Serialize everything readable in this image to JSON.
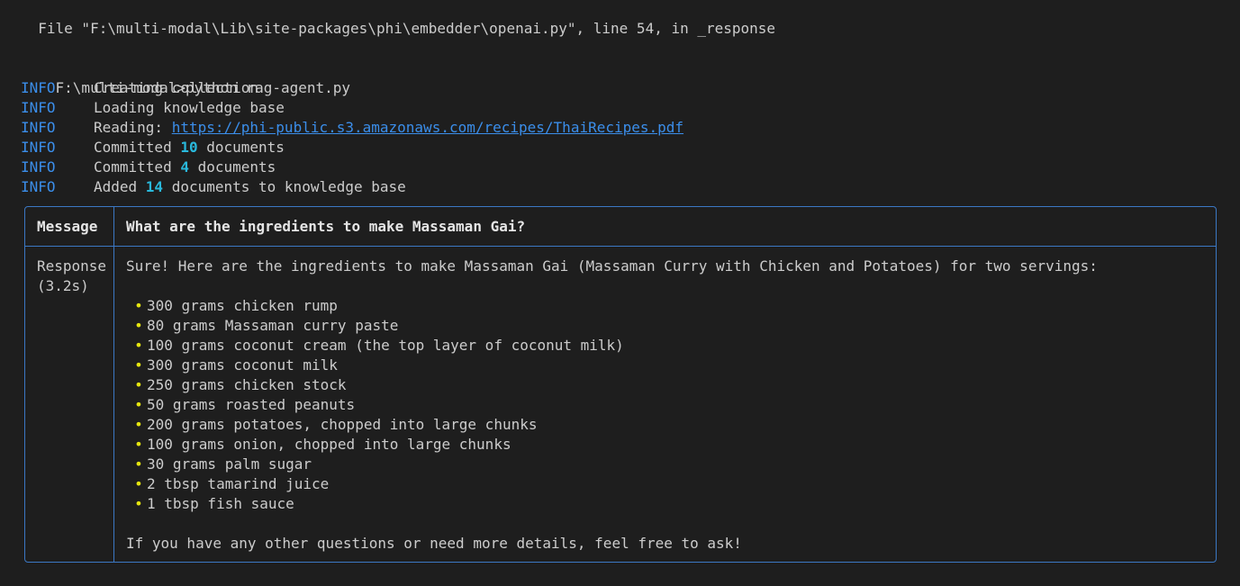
{
  "traceback_line": "  File \"F:\\multi-modal\\Lib\\site-packages\\phi\\embedder\\openai.py\", line 54, in _response",
  "prompt": {
    "path": "F:\\multi-modal>",
    "command": "python rag-agent.py"
  },
  "logs": [
    {
      "level": "INFO",
      "parts": [
        {
          "text": "Creating collection"
        }
      ]
    },
    {
      "level": "INFO",
      "parts": [
        {
          "text": "Loading knowledge base"
        }
      ]
    },
    {
      "level": "INFO",
      "parts": [
        {
          "text": "Reading: "
        },
        {
          "text": "https://phi-public.s3.amazonaws.com/recipes/ThaiRecipes.pdf",
          "kind": "link"
        }
      ]
    },
    {
      "level": "INFO",
      "parts": [
        {
          "text": "Committed "
        },
        {
          "text": "10",
          "kind": "num"
        },
        {
          "text": " documents"
        }
      ]
    },
    {
      "level": "INFO",
      "parts": [
        {
          "text": "Committed "
        },
        {
          "text": "4",
          "kind": "num"
        },
        {
          "text": " documents"
        }
      ]
    },
    {
      "level": "INFO",
      "parts": [
        {
          "text": "Added "
        },
        {
          "text": "14",
          "kind": "num"
        },
        {
          "text": " documents to knowledge base"
        }
      ]
    }
  ],
  "panel": {
    "message_label": "Message",
    "message_text": "What are the ingredients to make Massaman Gai?",
    "response_label_1": "Response",
    "response_label_2": "(3.2s)",
    "response_intro": "Sure! Here are the ingredients to make Massaman Gai (Massaman Curry with Chicken and Potatoes) for two servings:",
    "ingredients": [
      "300 grams chicken rump",
      "80 grams Massaman curry paste",
      "100 grams coconut cream (the top layer of coconut milk)",
      "300 grams coconut milk",
      "250 grams chicken stock",
      "50 grams roasted peanuts",
      "200 grams potatoes, chopped into large chunks",
      "100 grams onion, chopped into large chunks",
      "30 grams palm sugar",
      "2 tbsp tamarind juice",
      "1 tbsp fish sauce"
    ],
    "response_outro": "If you have any other questions or need more details, feel free to ask!"
  },
  "colors": {
    "background": "#1e1e1e",
    "text": "#cccccc",
    "info": "#3b8eea",
    "number": "#29b8db",
    "bullet": "#e5e510",
    "border": "#3b78c4"
  },
  "icons": {
    "bullet": "bullet-icon"
  }
}
